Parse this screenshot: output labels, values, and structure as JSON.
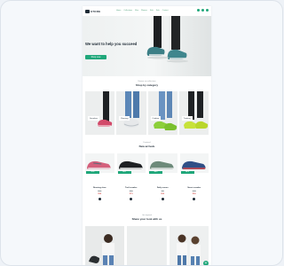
{
  "brand": {
    "logo_text": "STORE"
  },
  "nav": {
    "links": [
      "Home",
      "Collections",
      "Men",
      "Women",
      "Kids",
      "Sale",
      "Contact"
    ]
  },
  "hero": {
    "title": "We want to help you succeed",
    "cta": "Shop now"
  },
  "categories_section": {
    "subtitle": "Browse our collections",
    "title": "Shop by category",
    "items": [
      {
        "label": "Sneakers"
      },
      {
        "label": "Running"
      },
      {
        "label": "Outdoor"
      },
      {
        "label": "Training"
      }
    ]
  },
  "products_section": {
    "subtitle": "Featured",
    "title": "New arrivals",
    "items": [
      {
        "badge": "NEW",
        "name": "Running shoe",
        "old_price": "$120",
        "price": "$89"
      },
      {
        "badge": "NEW",
        "name": "Trail sneaker",
        "old_price": "$110",
        "price": "$79"
      },
      {
        "badge": "SALE",
        "name": "Daily runner",
        "old_price": "$99",
        "price": "$69"
      },
      {
        "badge": "SALE",
        "name": "Street sneaker",
        "old_price": "$130",
        "price": "$99"
      }
    ]
  },
  "gallery_section": {
    "subtitle": "Get inspired",
    "title": "Share your look with us"
  },
  "colors": {
    "accent": "#1fa77a",
    "dark": "#1f2b36",
    "sale": "#d9534f"
  },
  "fab": {
    "label": "+"
  }
}
